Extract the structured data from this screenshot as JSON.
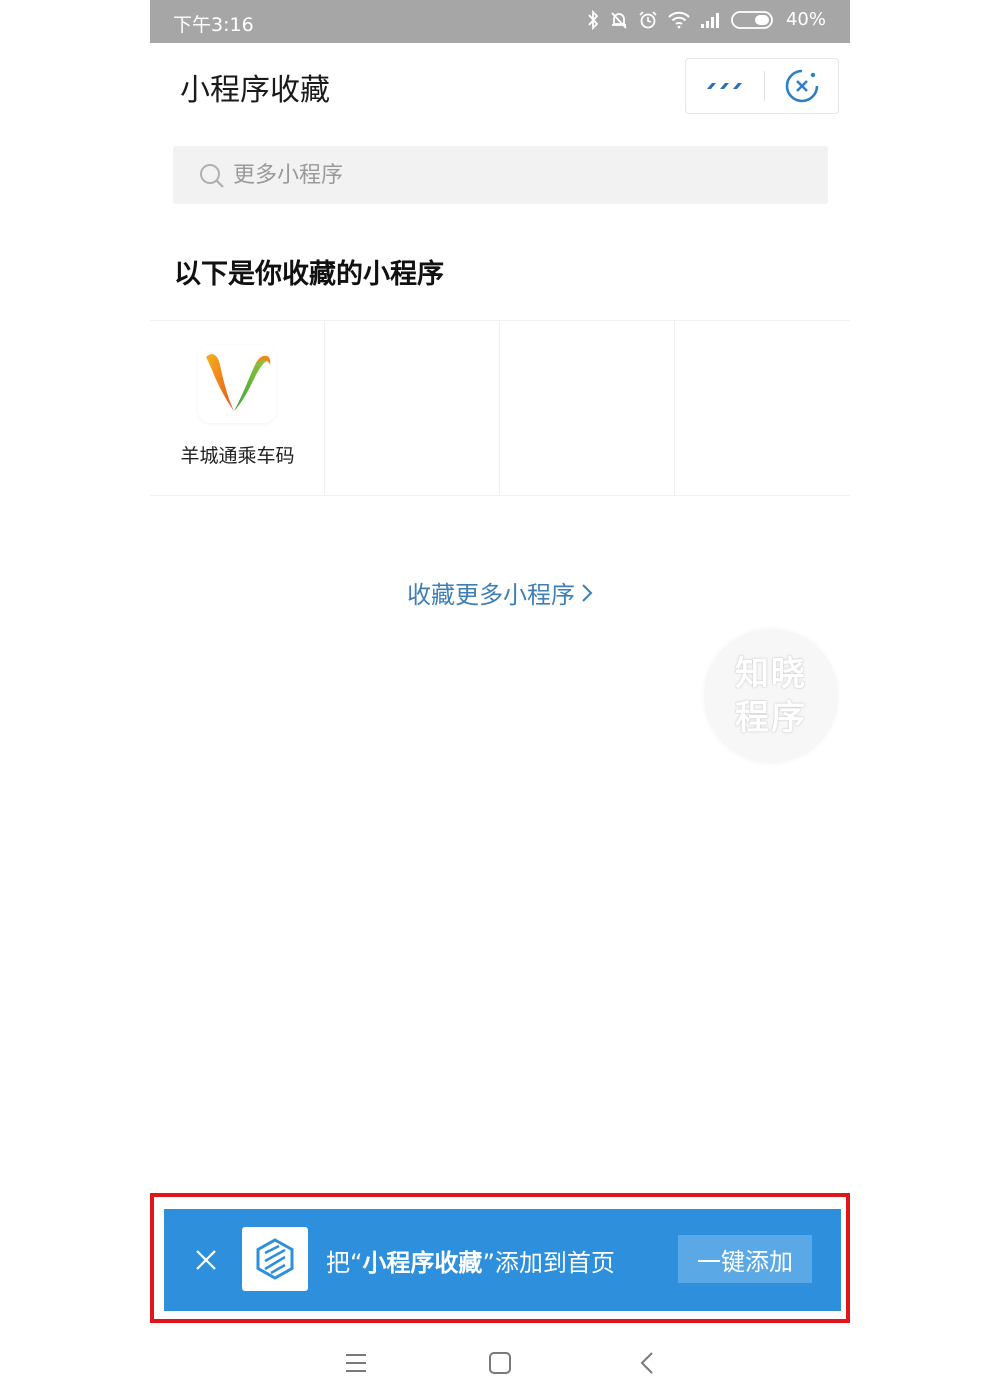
{
  "status_bar": {
    "time": "下午3:16",
    "battery": "40%"
  },
  "header": {
    "title": "小程序收藏"
  },
  "search": {
    "placeholder": "更多小程序"
  },
  "section_title": "以下是你收藏的小程序",
  "apps": [
    {
      "name": "羊城通乘车码",
      "icon": "yct-logo-icon"
    }
  ],
  "more_link": "收藏更多小程序",
  "watermark": {
    "line1": "知晓",
    "line2": "程序"
  },
  "banner": {
    "prefix": "把“",
    "highlight": "小程序收藏",
    "suffix": "”添加到首页",
    "add_button": "一键添加"
  },
  "colors": {
    "accent": "#2e90dc",
    "link": "#3e7fb5",
    "highlight_frame": "#e3141a"
  }
}
